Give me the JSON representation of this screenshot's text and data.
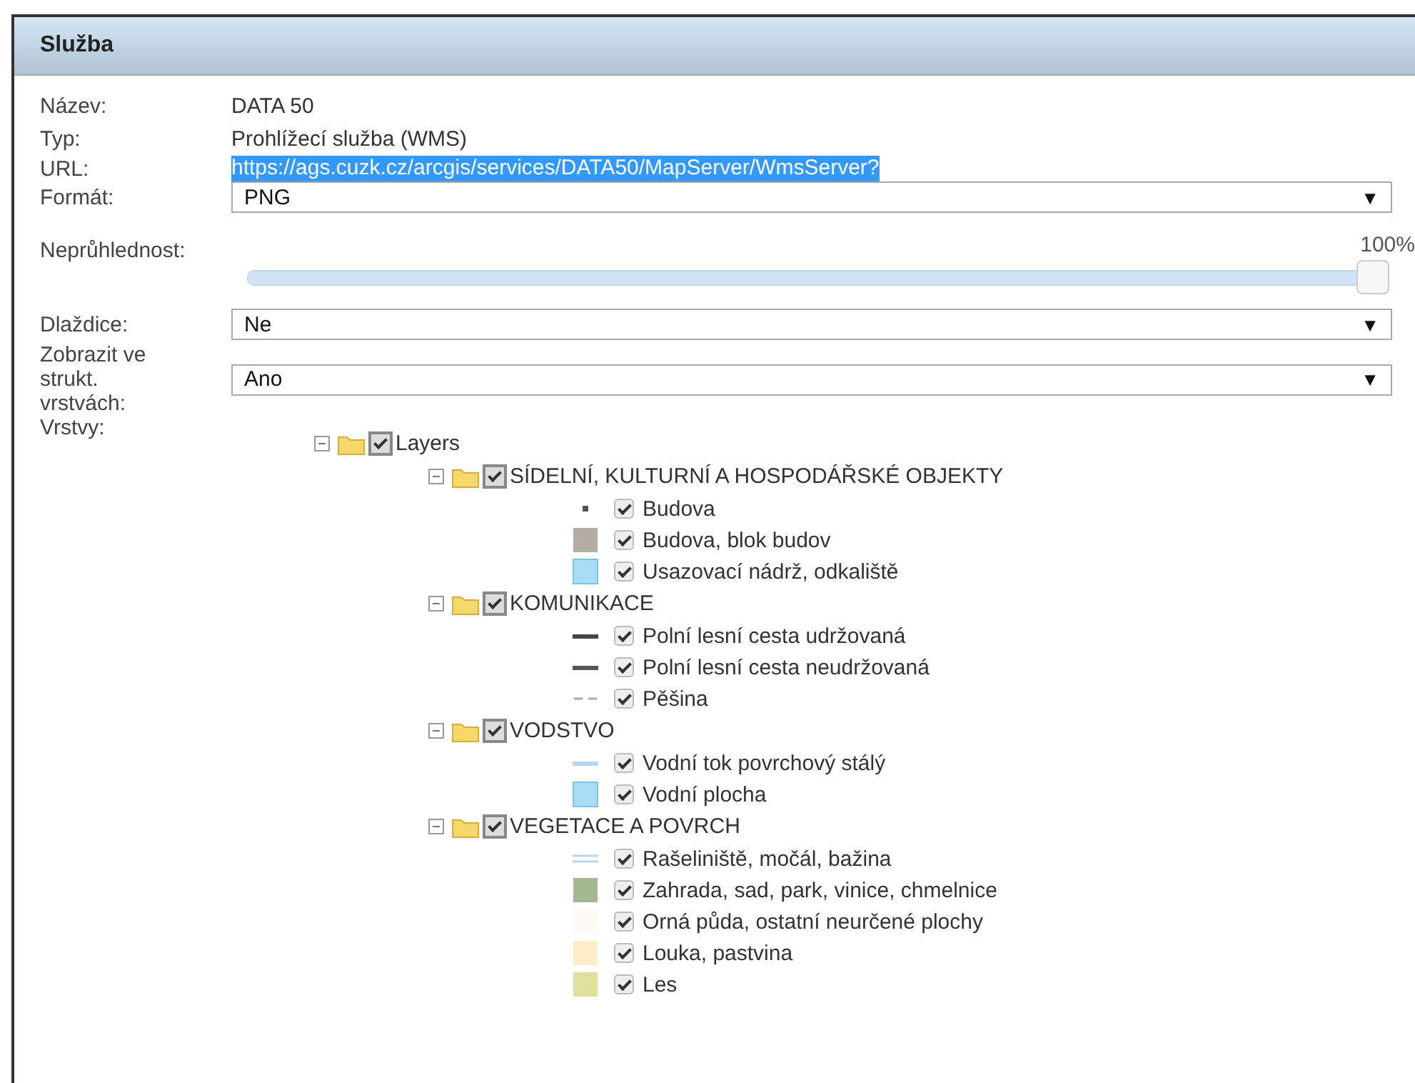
{
  "panel": {
    "title": "Služba"
  },
  "fields": [
    {
      "kind": "text",
      "label": "Název:",
      "value": "DATA 50"
    },
    {
      "kind": "text",
      "label": "Typ:",
      "value": "Prohlížecí služba (WMS)"
    },
    {
      "kind": "highlighted",
      "label": "URL:",
      "value": "https://ags.cuzk.cz/arcgis/services/DATA50/MapServer/WmsServer?"
    },
    {
      "kind": "select",
      "label": "Formát:",
      "value": "PNG",
      "arrow": "▼"
    },
    {
      "kind": "slider",
      "label": "Neprůhlednost:",
      "reading": "100%",
      "level": 1
    },
    {
      "kind": "select",
      "label": "Dlaždice:",
      "value": "Ne",
      "arrow": "▼"
    },
    {
      "kind": "select",
      "label": "Zobrazit ve strukt. vrstvách:",
      "value": "Ano",
      "arrow": "▼"
    }
  ],
  "layers": {
    "label": "Vrstvy:",
    "tree": [
      {
        "label": "Layers",
        "checked": true,
        "expanded": true,
        "children": [
          {
            "label": "SÍDELNÍ, KULTURNÍ A HOSPODÁŘSKÉ OBJEKTY",
            "checked": true,
            "expanded": true,
            "children": [
              {
                "label": "Budova",
                "checked": true,
                "kind": "dot",
                "color": "#555555"
              },
              {
                "label": "Budova, blok budov",
                "checked": true,
                "kind": "fill",
                "color": "#b3aca4"
              },
              {
                "label": "Usazovací nádrž, odkaliště",
                "checked": true,
                "kind": "fill",
                "color": "#a8dcf4"
              }
            ]
          },
          {
            "label": "KOMUNIKACE",
            "checked": true,
            "expanded": true,
            "children": [
              {
                "label": "Polní lesní cesta udržovaná",
                "checked": true,
                "kind": "line",
                "color": "#444444"
              },
              {
                "label": "Polní lesní cesta neudržovaná",
                "checked": true,
                "kind": "line",
                "color": "#555555"
              },
              {
                "label": "Pěšina",
                "checked": true,
                "kind": "dashed",
                "color": "#aaaaaa"
              }
            ]
          },
          {
            "label": "VODSTVO",
            "checked": true,
            "expanded": true,
            "children": [
              {
                "label": "Vodní tok povrchový stálý",
                "checked": true,
                "kind": "line",
                "color": "#b8d4f0"
              },
              {
                "label": "Vodní plocha",
                "checked": true,
                "kind": "fill",
                "color": "#a8dcf4"
              }
            ]
          },
          {
            "label": "VEGETACE A POVRCH",
            "checked": true,
            "expanded": true,
            "children": [
              {
                "label": "Rašeliniště, močál, bažina",
                "checked": true,
                "kind": "double",
                "color": "#b8d4f0"
              },
              {
                "label": "Zahrada, sad, park, vinice, chmelnice",
                "checked": true,
                "kind": "fill",
                "color": "#a4b894"
              },
              {
                "label": "Orná půda, ostatní neurčené plochy",
                "checked": true,
                "kind": "fill",
                "color": "#fdf9f5"
              },
              {
                "label": "Louka, pastvina",
                "checked": true,
                "kind": "fill",
                "color": "#fcecc8"
              },
              {
                "label": "Les",
                "checked": true,
                "kind": "fill",
                "color": "#dfe09c"
              }
            ]
          }
        ]
      }
    ]
  }
}
